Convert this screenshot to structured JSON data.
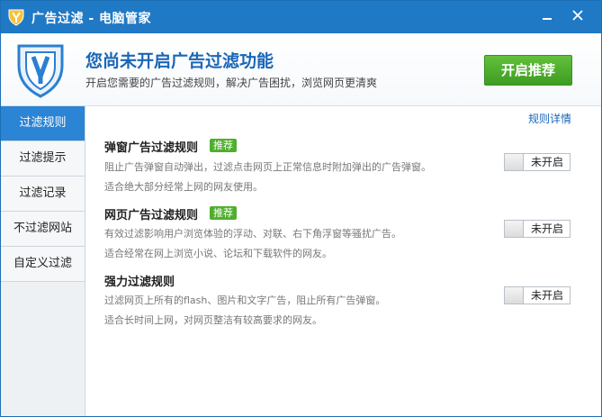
{
  "window": {
    "title": "广告过滤 - 电脑管家",
    "logo_icon": "tencent-pc-manager-shield-icon",
    "minimize_icon": "minimize-icon",
    "close_icon": "close-icon"
  },
  "header": {
    "title": "您尚未开启广告过滤功能",
    "description": "开启您需要的广告过滤规则，解决广告困扰，浏览网页更清爽",
    "enable_button": "开启推荐",
    "icon": "ad-filter-shield-icon"
  },
  "sidebar": {
    "items": [
      {
        "label": "过滤规则",
        "active": true
      },
      {
        "label": "过滤提示",
        "active": false
      },
      {
        "label": "过滤记录",
        "active": false
      },
      {
        "label": "不过滤网站",
        "active": false
      },
      {
        "label": "自定义过滤",
        "active": false
      }
    ]
  },
  "main": {
    "detail_link": "规则详情",
    "rules": [
      {
        "title": "弹窗广告过滤规则",
        "badge": "推荐",
        "desc1": "阻止广告弹窗自动弹出，过滤点击网页上正常信息时附加弹出的广告弹窗。",
        "desc2": "适合绝大部分经常上网的网友使用。",
        "toggle": "未开启"
      },
      {
        "title": "网页广告过滤规则",
        "badge": "推荐",
        "desc1": "有效过滤影响用户浏览体验的浮动、对联、右下角浮窗等骚扰广告。",
        "desc2": "适合经常在网上浏览小说、论坛和下载软件的网友。",
        "toggle": "未开启"
      },
      {
        "title": "强力过滤规则",
        "badge": "",
        "desc1": "过滤网页上所有的flash、图片和文字广告，阻止所有广告弹窗。",
        "desc2": "适合长时间上网，对网页整洁有较高要求的网友。",
        "toggle": "未开启"
      }
    ]
  },
  "colors": {
    "titlebar": "#2079c5",
    "accent_blue": "#1a66b8",
    "active_nav": "#2b84d4",
    "enable_green": "#4fae2d"
  }
}
